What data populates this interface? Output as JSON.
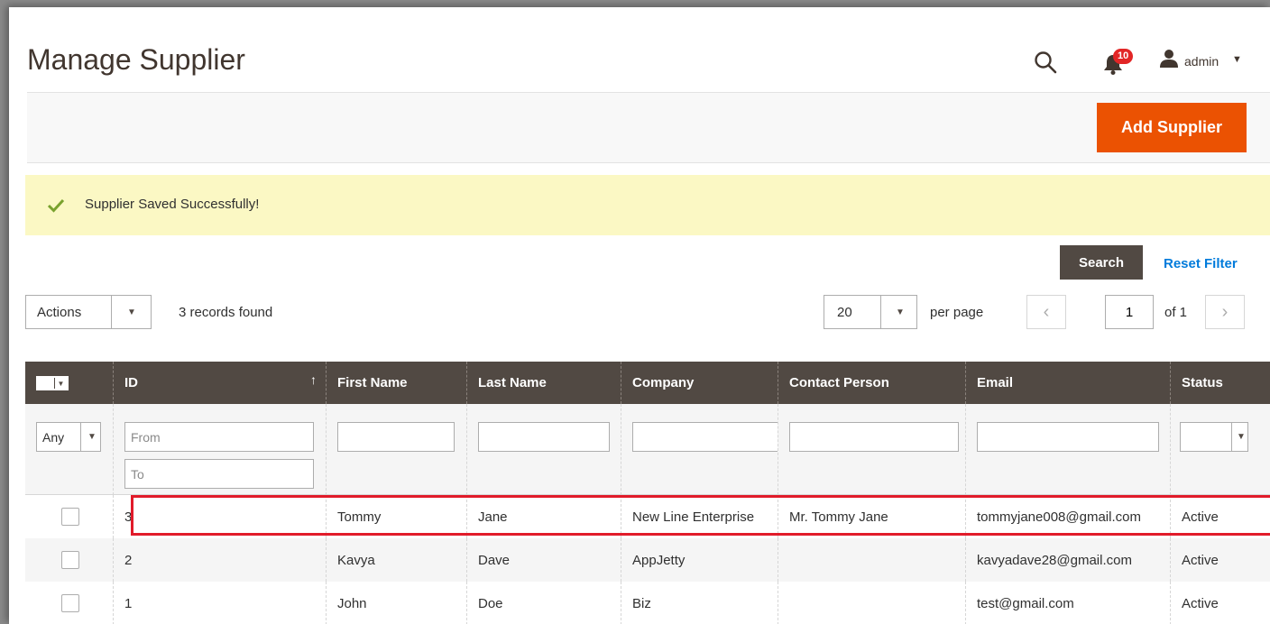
{
  "header": {
    "title": "Manage Supplier",
    "notification_count": "10",
    "user_label": "admin",
    "icons": [
      "search-icon",
      "bell-icon",
      "user-icon",
      "caret-down-icon"
    ]
  },
  "actionbar": {
    "add_label": "Add Supplier",
    "accent": "#eb5202"
  },
  "message": {
    "text": "Supplier Saved Successfully!",
    "icon": "check-icon",
    "accent": "#79a22e"
  },
  "grid": {
    "search_label": "Search",
    "reset_label": "Reset Filter",
    "actions_label": "Actions",
    "records_text": "3 records found",
    "per_page_value": "20",
    "per_page_label": "per page",
    "page_value": "1",
    "of_label": "of 1"
  },
  "table": {
    "columns": [
      "ID",
      "First Name",
      "Last Name",
      "Company",
      "Contact Person",
      "Email",
      "Status"
    ],
    "filters": {
      "any_label": "Any",
      "id_from_placeholder": "From",
      "id_to_placeholder": "To"
    },
    "rows": [
      {
        "id": "3",
        "first_name": "Tommy",
        "last_name": "Jane",
        "company": "New Line Enterprise",
        "contact_person": "Mr. Tommy Jane",
        "email": "tommyjane008@gmail.com",
        "status": "Active",
        "highlighted": true
      },
      {
        "id": "2",
        "first_name": "Kavya",
        "last_name": "Dave",
        "company": "AppJetty",
        "contact_person": "",
        "email": "kavyadave28@gmail.com",
        "status": "Active",
        "highlighted": false
      },
      {
        "id": "1",
        "first_name": "John",
        "last_name": "Doe",
        "company": "Biz",
        "contact_person": "",
        "email": "test@gmail.com",
        "status": "Active",
        "highlighted": false
      }
    ],
    "header_bg": "#514943",
    "highlight_color": "#e11b2a"
  }
}
